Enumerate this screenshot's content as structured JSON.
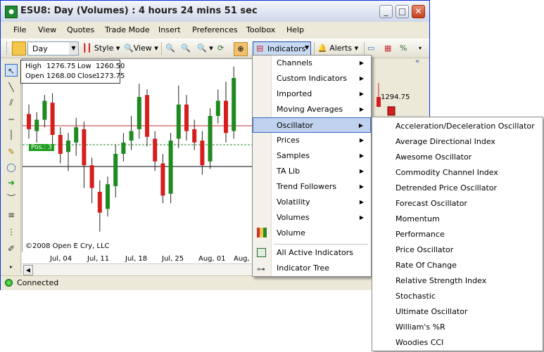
{
  "window": {
    "title": "ESU8: Day (Volumes) : 4 hours 24 mins 51 sec",
    "minimize": "_",
    "maximize": "□",
    "close": "✕"
  },
  "menubar": [
    "File",
    "View",
    "Quotes",
    "Trade Mode",
    "Insert",
    "Preferences",
    "Toolbox",
    "Help"
  ],
  "toolbar": {
    "interval": "Day",
    "style_label": "Style",
    "view_label": "View",
    "indicators_label": "Indicators",
    "alerts_label": "Alerts"
  },
  "ohlc": {
    "high_label": "High",
    "high": "1276.75",
    "low_label": "Low",
    "low": "1260.50",
    "open_label": "Open",
    "open": "1268.00",
    "close_label": "Close",
    "close": "1273.75"
  },
  "chart": {
    "position_tag": "Pos.: 3",
    "copyright": "©2008 Open E Cry, LLC",
    "price_label": "1294.75",
    "x_ticks": [
      "Jul, 04",
      "Jul, 11",
      "Jul, 18",
      "Jul, 25",
      "Aug, 01",
      "Aug, 0"
    ],
    "candles": [
      {
        "o": 1271,
        "c": 1263,
        "h": 1276,
        "l": 1258
      },
      {
        "o": 1262,
        "c": 1268,
        "h": 1272,
        "l": 1256
      },
      {
        "o": 1268,
        "c": 1278,
        "h": 1281,
        "l": 1264
      },
      {
        "o": 1277,
        "c": 1260,
        "h": 1282,
        "l": 1253
      },
      {
        "o": 1260,
        "c": 1250,
        "h": 1264,
        "l": 1245
      },
      {
        "o": 1251,
        "c": 1257,
        "h": 1261,
        "l": 1241
      },
      {
        "o": 1256,
        "c": 1264,
        "h": 1269,
        "l": 1249
      },
      {
        "o": 1263,
        "c": 1244,
        "h": 1267,
        "l": 1232
      },
      {
        "o": 1244,
        "c": 1232,
        "h": 1248,
        "l": 1224
      },
      {
        "o": 1230,
        "c": 1219,
        "h": 1236,
        "l": 1209
      },
      {
        "o": 1221,
        "c": 1234,
        "h": 1238,
        "l": 1217
      },
      {
        "o": 1233,
        "c": 1250,
        "h": 1255,
        "l": 1227
      },
      {
        "o": 1250,
        "c": 1256,
        "h": 1261,
        "l": 1246
      },
      {
        "o": 1257,
        "c": 1262,
        "h": 1270,
        "l": 1252
      },
      {
        "o": 1263,
        "c": 1280,
        "h": 1287,
        "l": 1258
      },
      {
        "o": 1281,
        "c": 1259,
        "h": 1284,
        "l": 1254
      },
      {
        "o": 1258,
        "c": 1246,
        "h": 1262,
        "l": 1241
      },
      {
        "o": 1245,
        "c": 1228,
        "h": 1250,
        "l": 1224
      },
      {
        "o": 1229,
        "c": 1257,
        "h": 1261,
        "l": 1224
      },
      {
        "o": 1258,
        "c": 1276,
        "h": 1286,
        "l": 1253
      },
      {
        "o": 1276,
        "c": 1262,
        "h": 1281,
        "l": 1257
      },
      {
        "o": 1263,
        "c": 1256,
        "h": 1268,
        "l": 1252
      },
      {
        "o": 1257,
        "c": 1244,
        "h": 1262,
        "l": 1239
      },
      {
        "o": 1246,
        "c": 1270,
        "h": 1274,
        "l": 1242
      },
      {
        "o": 1270,
        "c": 1278,
        "h": 1284,
        "l": 1266
      },
      {
        "o": 1278,
        "c": 1261,
        "h": 1288,
        "l": 1256
      },
      {
        "o": 1262,
        "c": 1290,
        "h": 1296,
        "l": 1258
      }
    ]
  },
  "indicators_menu": {
    "items": [
      {
        "label": "Channels",
        "submenu": true
      },
      {
        "label": "Custom Indicators",
        "submenu": true
      },
      {
        "label": "Imported",
        "submenu": true
      },
      {
        "label": "Moving Averages",
        "submenu": true
      },
      {
        "label": "Oscillator",
        "submenu": true,
        "highlighted": true
      },
      {
        "label": "Prices",
        "submenu": true
      },
      {
        "label": "Samples",
        "submenu": true
      },
      {
        "label": "TA Lib",
        "submenu": true
      },
      {
        "label": "Trend Followers",
        "submenu": true
      },
      {
        "label": "Volatility",
        "submenu": true
      },
      {
        "label": "Volumes",
        "submenu": true
      },
      {
        "label": "Volume",
        "submenu": false
      }
    ],
    "bottom_items": [
      "All Active Indicators",
      "Indicator Tree"
    ]
  },
  "oscillator_menu": {
    "items": [
      "Acceleration/Deceleration Oscillator",
      "Average Directional Index",
      "Awesome Oscillator",
      "Commodity Channel Index",
      "Detrended Price Oscillator",
      "Forecast Oscillator",
      "Momentum",
      "Performance",
      "Price Oscillator",
      "Rate Of Change",
      "Relative Strength Index",
      "Stochastic",
      "Ultimate Oscillator",
      "William's %R",
      "Woodies CCI"
    ]
  },
  "status": {
    "text": "Connected",
    "color": "#1ea61e"
  },
  "colors": {
    "up": "#1f8a1f",
    "down": "#d71e1e",
    "accent": "#316ac5"
  }
}
